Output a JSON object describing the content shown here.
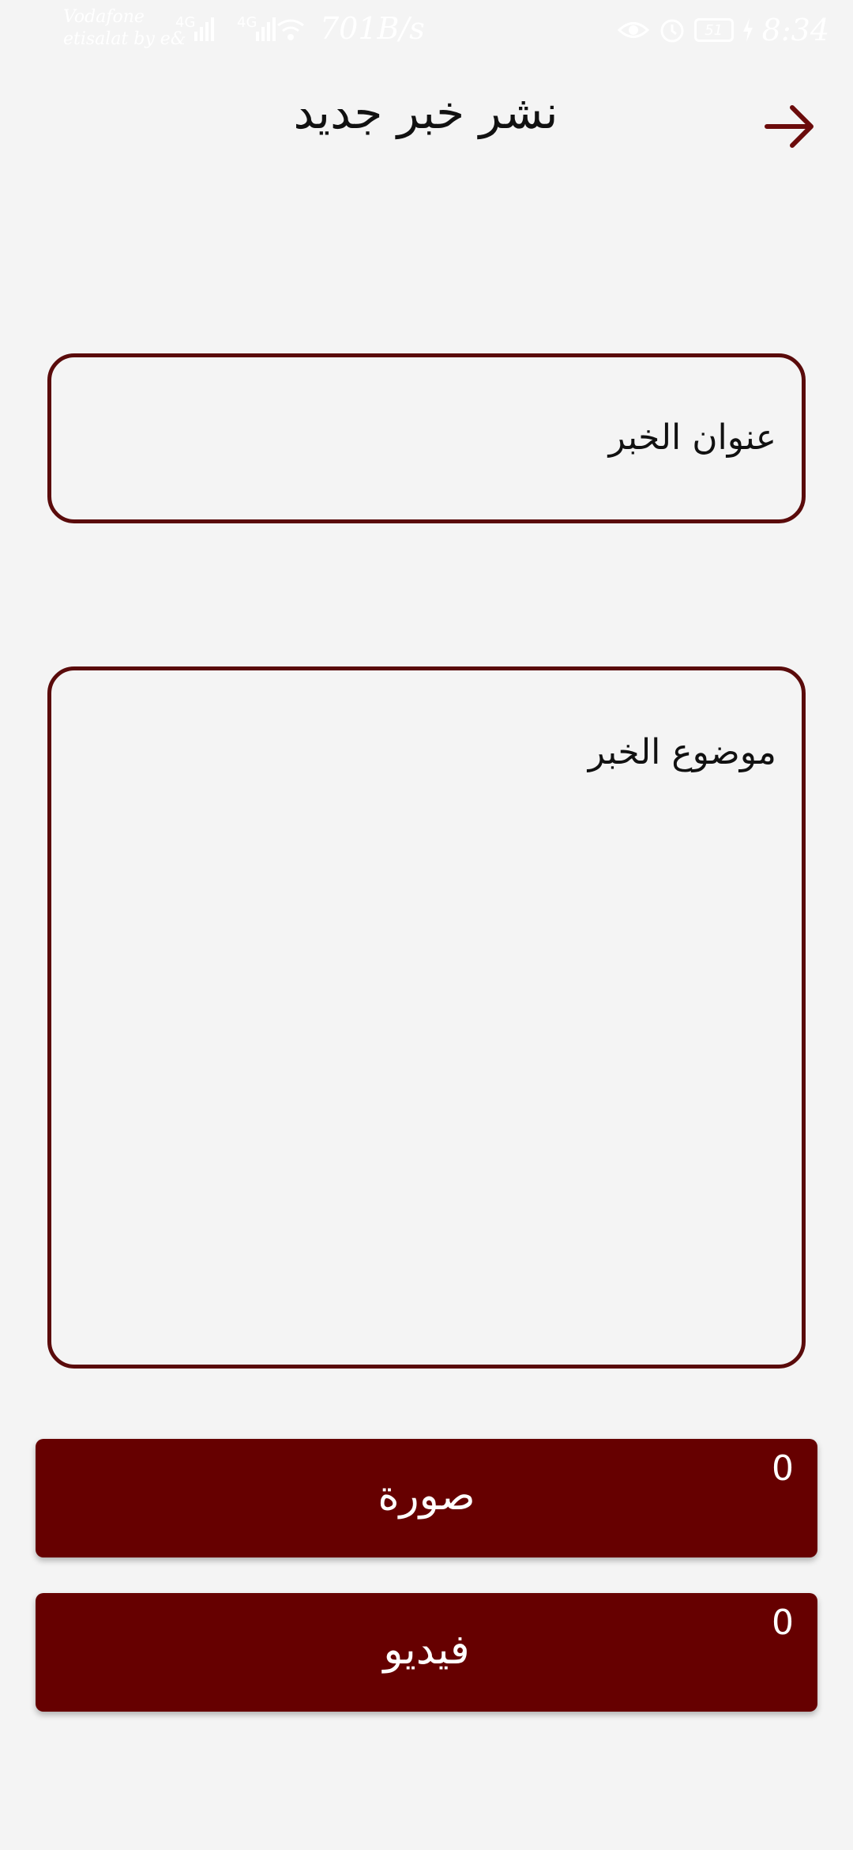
{
  "status_bar": {
    "carrier_line1": "Vodafone",
    "carrier_line2": "etisalat by e&",
    "net_speed": "701B/s",
    "battery": "51",
    "time": "8:34",
    "icons": [
      "signal-icon",
      "signal-icon",
      "wifi-icon",
      "eye-icon",
      "alarm-icon",
      "battery-icon",
      "charging-icon"
    ]
  },
  "header": {
    "title": "نشر خبر جديد",
    "back_icon": "arrow-right-icon"
  },
  "form": {
    "title_placeholder": "عنوان الخبر",
    "body_placeholder": "موضوع الخبر"
  },
  "buttons": {
    "image_label": "صورة",
    "image_count": "0",
    "video_label": "فيديو",
    "video_count": "0"
  },
  "colors": {
    "accent": "#660000",
    "border": "#5a0b0b",
    "background": "#f4f4f4"
  }
}
